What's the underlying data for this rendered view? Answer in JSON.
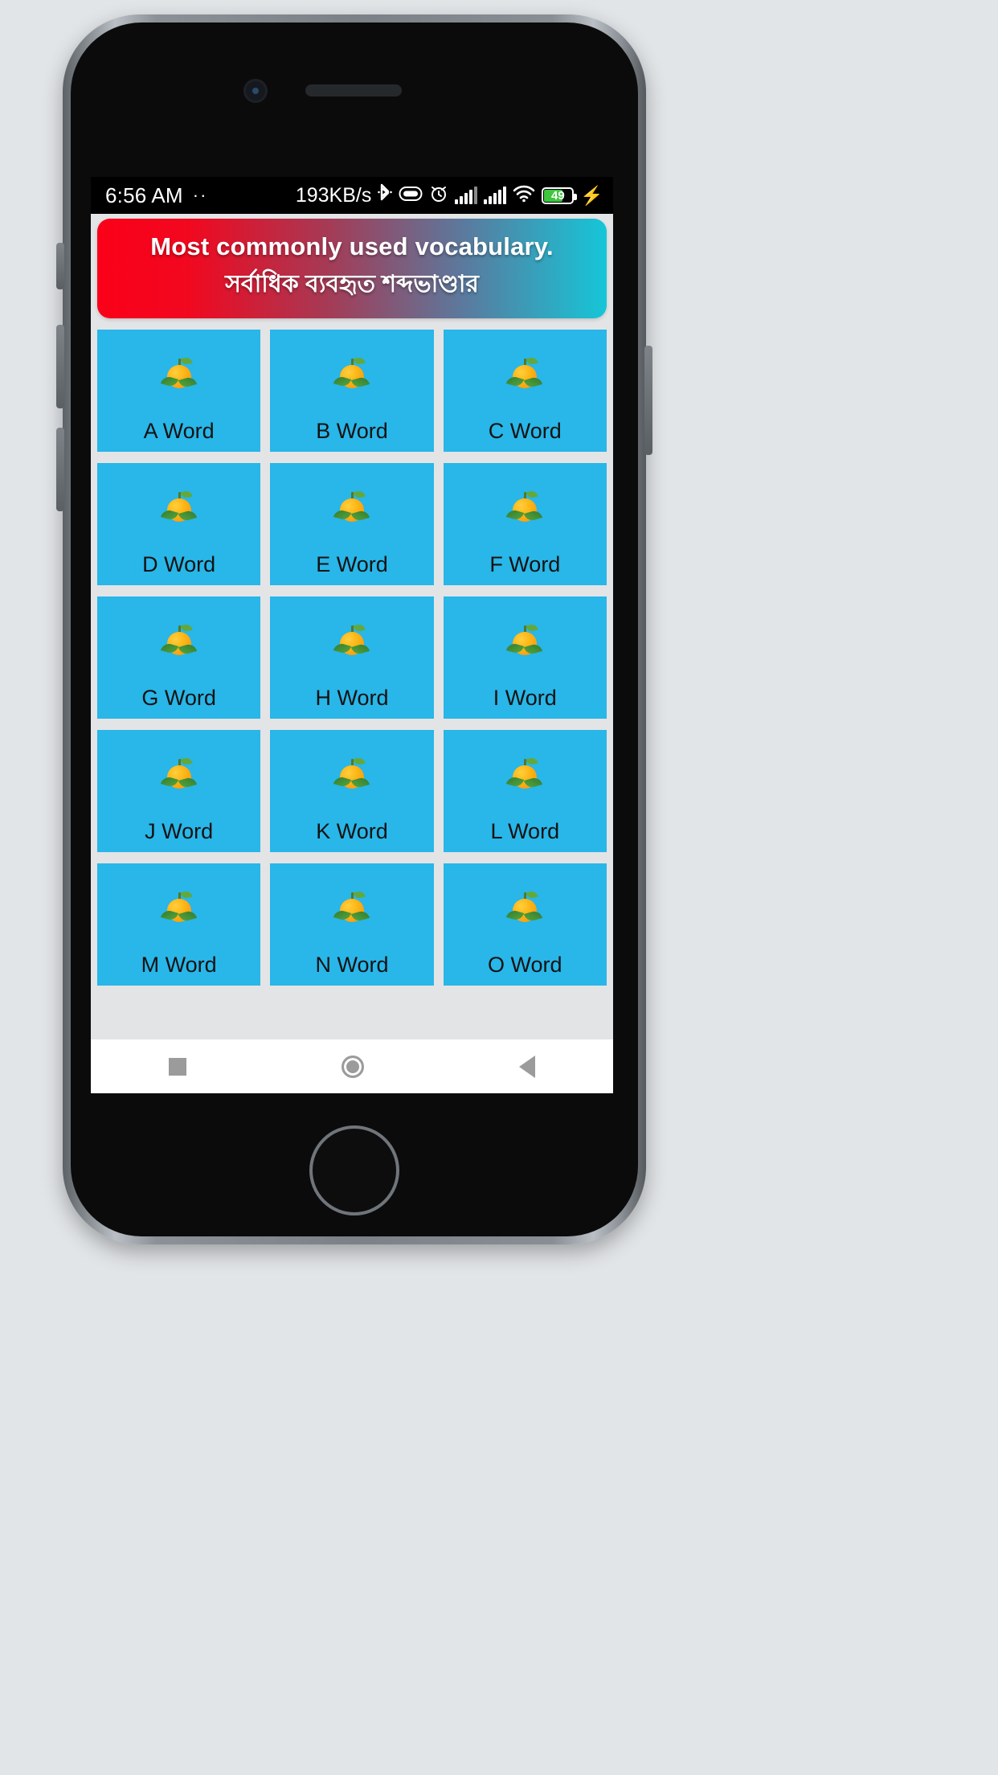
{
  "status_bar": {
    "time": "6:56 AM",
    "dots": "··",
    "network_speed": "193KB/s",
    "icons": [
      "bluetooth-icon",
      "do-not-disturb-icon",
      "alarm-icon",
      "signal-sim1-icon",
      "signal-sim2-icon",
      "wifi-icon",
      "battery-icon",
      "charging-bolt-icon"
    ],
    "battery_level": "49",
    "battery_color": "#3ec63e"
  },
  "banner": {
    "title_en": "Most commonly used vocabulary.",
    "title_bn": "সর্বাধিক ব্যবহৃত শব্দভাণ্ডার",
    "gradient_start": "#fb0019",
    "gradient_end": "#15c6d8"
  },
  "grid": {
    "card_color": "#29b6e8",
    "icon": "orange-fruit-icon",
    "items": [
      {
        "label": "A Word"
      },
      {
        "label": "B Word"
      },
      {
        "label": "C Word"
      },
      {
        "label": "D Word"
      },
      {
        "label": "E Word"
      },
      {
        "label": "F Word"
      },
      {
        "label": "G Word"
      },
      {
        "label": "H Word"
      },
      {
        "label": "I Word"
      },
      {
        "label": "J Word"
      },
      {
        "label": "K Word"
      },
      {
        "label": "L Word"
      },
      {
        "label": "M Word"
      },
      {
        "label": "N Word"
      },
      {
        "label": "O Word"
      }
    ]
  },
  "nav_bar": {
    "recents": "recents-square-icon",
    "home": "home-circle-icon",
    "back": "back-triangle-icon"
  }
}
